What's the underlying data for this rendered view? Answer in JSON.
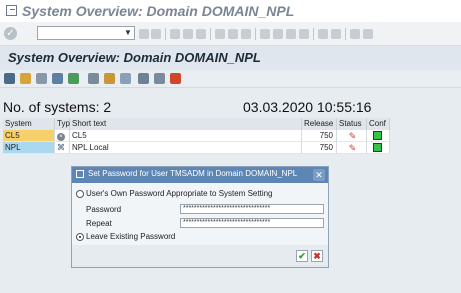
{
  "app_title": "System Overview: Domain DOMAIN_NPL",
  "screen_title": "System Overview: Domain DOMAIN_NPL",
  "overview": {
    "count_label": "No. of systems:  2",
    "datetime": "03.03.2020 10:55:16"
  },
  "table": {
    "headers": [
      "System",
      "Typ",
      "Short text",
      "Release",
      "Status",
      "Conf"
    ],
    "rows": [
      {
        "system": "CL5",
        "typ_icon": "delete-icon",
        "short_text": "CL5",
        "release": "750",
        "status_icon": "pencil-icon",
        "conf_status": "green"
      },
      {
        "system": "NPL",
        "typ_icon": "system-node-icon",
        "short_text": "NPL Local",
        "release": "750",
        "status_icon": "pencil-icon",
        "conf_status": "green"
      }
    ]
  },
  "dialog": {
    "title": "Set Password for User TMSADM in Domain DOMAIN_NPL",
    "option_own": "User's Own Password Appropriate to System Setting",
    "password_label": "Password",
    "password_value": "********************************",
    "repeat_label": "Repeat",
    "repeat_value": "********************************",
    "option_leave": "Leave Existing Password",
    "selected": "leave"
  },
  "colors": {
    "cl5_row": "#f6d16b",
    "npl_row": "#a9d8f0",
    "dialog_title": "#5e86b4",
    "status_green": "#36c24a"
  }
}
